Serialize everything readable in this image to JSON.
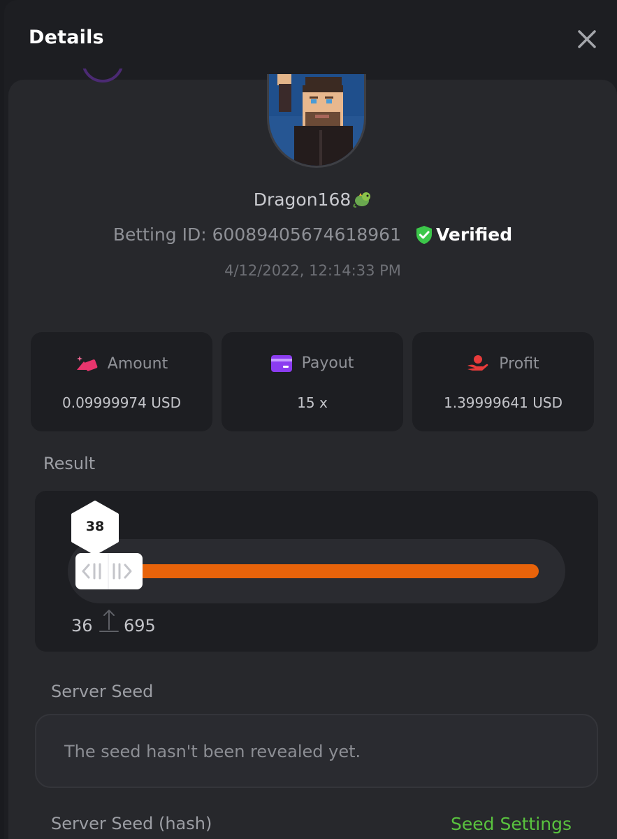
{
  "modal": {
    "title": "Details",
    "close_icon": "close-icon"
  },
  "player": {
    "username": "Dragon168",
    "username_emoji_icon": "dragon-emoji-icon",
    "betting_id_label": "Betting ID:",
    "betting_id": "60089405674618961",
    "verified_label": "Verified",
    "verified_icon": "shield-check-icon",
    "timestamp": "4/12/2022, 12:14:33 PM"
  },
  "stats": [
    {
      "label": "Amount",
      "value": "0.09999974 USD",
      "icon": "coins-icon",
      "color": "#e8356d"
    },
    {
      "label": "Payout",
      "value": "15 x",
      "icon": "card-icon",
      "color": "#8b3cf0"
    },
    {
      "label": "Profit",
      "value": "1.39999641 USD",
      "icon": "hand-coin-icon",
      "color": "#e83b3b"
    }
  ],
  "result": {
    "label": "Result",
    "roll": "38",
    "range_min": "36",
    "range_max": "695",
    "bar_color": "#e8630a"
  },
  "server_seed": {
    "label": "Server Seed",
    "value": "The seed hasn't been revealed yet.",
    "hash_label": "Server Seed (hash)",
    "settings_link": "Seed Settings",
    "settings_color": "#59c23e"
  }
}
